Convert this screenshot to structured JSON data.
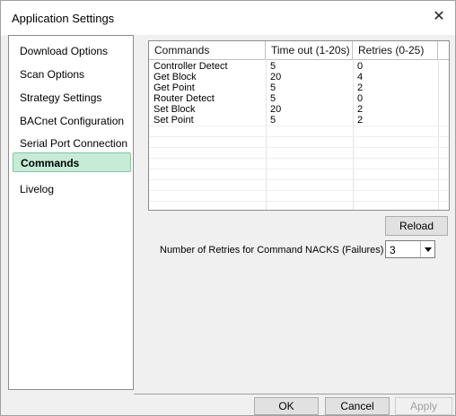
{
  "window": {
    "title": "Application Settings",
    "close_glyph": "✕"
  },
  "sidebar": {
    "items": [
      {
        "label": "Download Options",
        "active": false
      },
      {
        "label": "Scan Options",
        "active": false
      },
      {
        "label": "Strategy Settings",
        "active": false
      },
      {
        "label": "BACnet Configuration",
        "active": false
      },
      {
        "label": "Serial Port Connection",
        "active": false
      },
      {
        "label": "Commands",
        "active": true
      },
      {
        "label": "Livelog",
        "active": false
      }
    ]
  },
  "commands_table": {
    "headers": [
      "Commands",
      "Time out (1-20s)",
      "Retries (0-25)"
    ],
    "rows": [
      [
        "Controller Detect",
        "5",
        "0"
      ],
      [
        "Get Block",
        "20",
        "4"
      ],
      [
        "Get Point",
        "5",
        "2"
      ],
      [
        "Router Detect",
        "5",
        "0"
      ],
      [
        "Set Block",
        "20",
        "2"
      ],
      [
        "Set Point",
        "5",
        "2"
      ]
    ]
  },
  "reload_label": "Reload",
  "retries": {
    "label": "Number of Retries for Command NACKS (Failures)",
    "value": "3"
  },
  "footer": {
    "ok": "OK",
    "cancel": "Cancel",
    "apply": "Apply"
  },
  "colors": {
    "active_nav_bg": "#c6ecd6",
    "active_nav_border": "#7fc7a0"
  }
}
